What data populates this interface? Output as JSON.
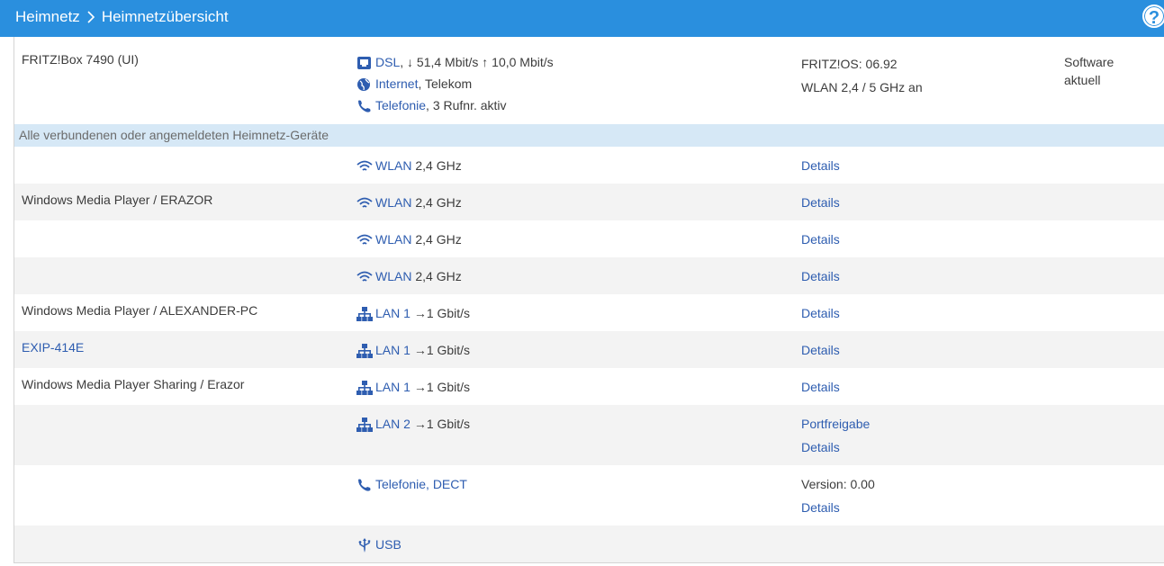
{
  "header": {
    "crumb_root": "Heimnetz",
    "crumb_current": "Heimnetzübersicht",
    "help_label": "?"
  },
  "box": {
    "name": "FRITZ!Box 7490 (UI)",
    "dsl_label": "DSL",
    "dsl_speed": ", ↓ 51,4 Mbit/s ↑ 10,0 Mbit/s",
    "internet_label": "Internet",
    "internet_provider": ", Telekom",
    "phone_label": "Telefonie",
    "phone_detail": ", 3 Rufnr. aktiv",
    "os": "FRITZ!OS: 06.92",
    "wlan": "WLAN 2,4 / 5 GHz an",
    "software_line1": "Software",
    "software_line2": "aktuell"
  },
  "section_title": "Alle verbundenen oder angemeldeten Heimnetz-Geräte",
  "devices": [
    {
      "name": "",
      "type": "wlan",
      "conn_label": "WLAN",
      "conn_detail": "2,4 GHz",
      "actions": [
        "Details"
      ]
    },
    {
      "name": "Windows Media Player / ERAZOR",
      "type": "wlan",
      "conn_label": "WLAN",
      "conn_detail": "2,4 GHz",
      "actions": [
        "Details"
      ]
    },
    {
      "name": "",
      "type": "wlan",
      "conn_label": "WLAN",
      "conn_detail": "2,4 GHz",
      "actions": [
        "Details"
      ]
    },
    {
      "name": "",
      "type": "wlan",
      "conn_label": "WLAN",
      "conn_detail": "2,4 GHz",
      "actions": [
        "Details"
      ]
    },
    {
      "name": "Windows Media Player / ALEXANDER-PC",
      "type": "lan",
      "conn_label": "LAN 1",
      "conn_detail": "→1 Gbit/s",
      "actions": [
        "Details"
      ]
    },
    {
      "name": "EXIP-414E",
      "type": "lan",
      "conn_label": "LAN 1",
      "conn_detail": "→1 Gbit/s",
      "actions": [
        "Details"
      ]
    },
    {
      "name": "Windows Media Player Sharing / Erazor",
      "type": "lan",
      "conn_label": "LAN 1",
      "conn_detail": "→1 Gbit/s",
      "actions": [
        "Details"
      ]
    },
    {
      "name": "",
      "type": "lan",
      "conn_label": "LAN 2",
      "conn_detail": "→1 Gbit/s",
      "actions": [
        "Portfreigabe",
        "Details"
      ]
    },
    {
      "name": "",
      "type": "phone",
      "conn_label": "Telefonie, DECT",
      "conn_detail": "",
      "version": "Version: 0.00",
      "actions": [
        "Details"
      ]
    },
    {
      "name": "",
      "type": "usb",
      "conn_label": "USB",
      "conn_detail": "",
      "actions": []
    }
  ],
  "colors": {
    "header_bg": "#2a8fde",
    "link": "#2e5db0",
    "section_bg": "#d6e8f6",
    "row_alt": "#f3f3f3"
  }
}
